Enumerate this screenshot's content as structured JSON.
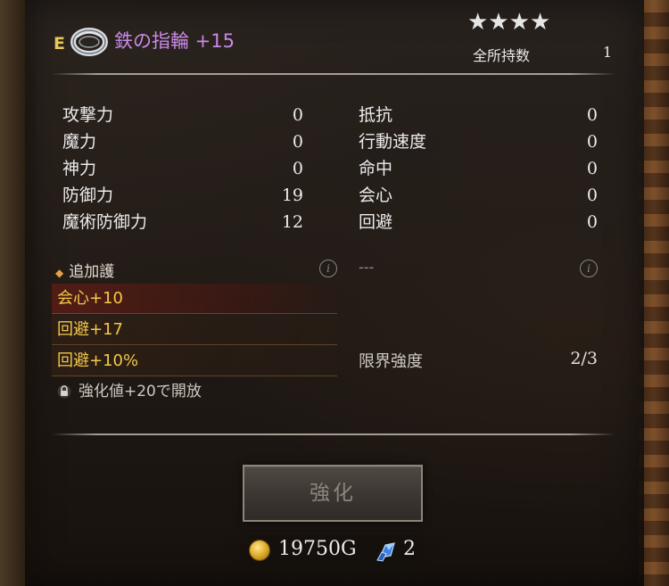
{
  "item": {
    "grade": "E",
    "icon": "ring-icon",
    "name": "鉄の指輪 +15",
    "stars": "★★★★",
    "star_count": 4,
    "owned_label": "全所持数",
    "owned_value": "1"
  },
  "stats_left": [
    {
      "label": "攻撃力",
      "value": "0"
    },
    {
      "label": "魔力",
      "value": "0"
    },
    {
      "label": "神力",
      "value": "0"
    },
    {
      "label": "防御力",
      "value": "19"
    },
    {
      "label": "魔術防御力",
      "value": "12"
    }
  ],
  "stats_right": [
    {
      "label": "抵抗",
      "value": "0"
    },
    {
      "label": "行動速度",
      "value": "0"
    },
    {
      "label": "命中",
      "value": "0"
    },
    {
      "label": "会心",
      "value": "0"
    },
    {
      "label": "回避",
      "value": "0"
    }
  ],
  "extra": {
    "header": "追加護",
    "options": [
      "会心+10",
      "回避+17",
      "回避+10%"
    ],
    "lock_text": "強化値+20で開放",
    "right_placeholder": "---"
  },
  "limit": {
    "label": "限界強度",
    "value": "2/3"
  },
  "actions": {
    "enhance_label": "強化"
  },
  "cost": {
    "gold": "19750G",
    "stones": "2"
  },
  "colors": {
    "item_name": "#c88ae8",
    "option_text": "#f2c84a",
    "grade": "#e8c65a"
  }
}
